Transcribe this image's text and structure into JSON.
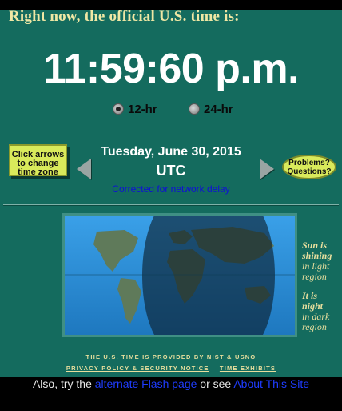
{
  "header": {
    "headline": "Right now, the official U.S. time is:"
  },
  "clock": {
    "time": "11:59:60 p.m."
  },
  "format": {
    "option_12": {
      "label": "12-hr",
      "selected": true
    },
    "option_24": {
      "label": "24-hr",
      "selected": false
    }
  },
  "zone_panel": {
    "change_button_lines": [
      "Click arrows",
      "to change",
      "time zone"
    ],
    "date": "Tuesday, June 30, 2015",
    "zone": "UTC",
    "correction": "Corrected for network delay",
    "problems_lines": [
      "Problems?",
      "Questions?"
    ]
  },
  "map": {
    "sun_text": [
      "Sun is",
      "shining",
      "in light",
      "region"
    ],
    "night_text": [
      "It is",
      "night",
      "in dark",
      "region"
    ],
    "colors": {
      "ocean_day": "#2b8fd6",
      "ocean_night": "#123a57",
      "land_day": "#5f7a5a",
      "land_night": "#2a3a2a"
    }
  },
  "footer": {
    "provided": "THE U.S. TIME IS PROVIDED BY NIST & USNO",
    "privacy_link": "PRIVACY POLICY & SECURITY NOTICE",
    "exhibits_link": "TIME EXHIBITS"
  },
  "bottom": {
    "prefix": "Also, try the",
    "flash_link": "alternate Flash page",
    "middle": "or see",
    "about_link": "About This Site"
  },
  "colors": {
    "panel": "#146b5e",
    "headline": "#efe7a4",
    "button_yellow": "#d9ea5b",
    "link_blue": "#1f3dff"
  }
}
